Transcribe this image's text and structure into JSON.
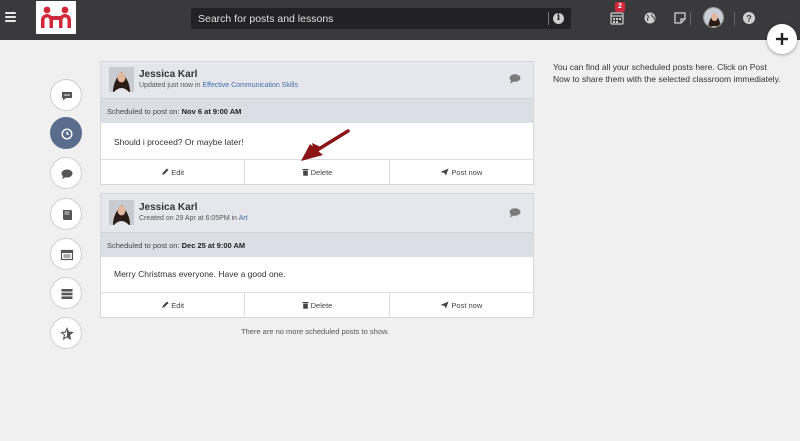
{
  "topbar": {
    "search_placeholder": "Search for posts and lessons",
    "calendar_badge": "2",
    "icons": [
      "menu-icon",
      "calendar-icon",
      "globe-icon",
      "note-icon",
      "help-icon",
      "plus-icon"
    ],
    "brand_color": "#d0273a"
  },
  "sidebar": {
    "items": [
      {
        "icon": "conversations-icon",
        "active": false
      },
      {
        "icon": "clock-icon",
        "active": true
      },
      {
        "icon": "comment-icon",
        "active": false
      },
      {
        "icon": "book-icon",
        "active": false
      },
      {
        "icon": "calendar-grid-icon",
        "active": false
      },
      {
        "icon": "list-icon",
        "active": false
      },
      {
        "icon": "star-icon",
        "active": false
      }
    ],
    "active_color": "#5a6d8c"
  },
  "posts": [
    {
      "author": "Jessica Karl",
      "meta_prefix": "Updated just now in ",
      "meta_link": "Effective Communication Skills",
      "scheduled_label": "Scheduled to post on: ",
      "scheduled_date": "Nov 6 at 9:00 AM",
      "body": "Should i proceed? Or maybe later!",
      "edit": "Edit",
      "delete": "Delete",
      "post_now": "Post now"
    },
    {
      "author": "Jessica Karl",
      "meta_prefix": "Created on 29 Apr at 6:05PM in ",
      "meta_link": "Art",
      "scheduled_label": "Scheduled to post on: ",
      "scheduled_date": "Dec 25 at 9:00 AM",
      "body": "Merry Christmas everyone. Have a good one.",
      "edit": "Edit",
      "delete": "Delete",
      "post_now": "Post now"
    }
  ],
  "footer_note": "There are no more scheduled posts to show.",
  "info_note": "You can find all your scheduled posts here. Click on Post Now to share them with the selected classroom immediately."
}
